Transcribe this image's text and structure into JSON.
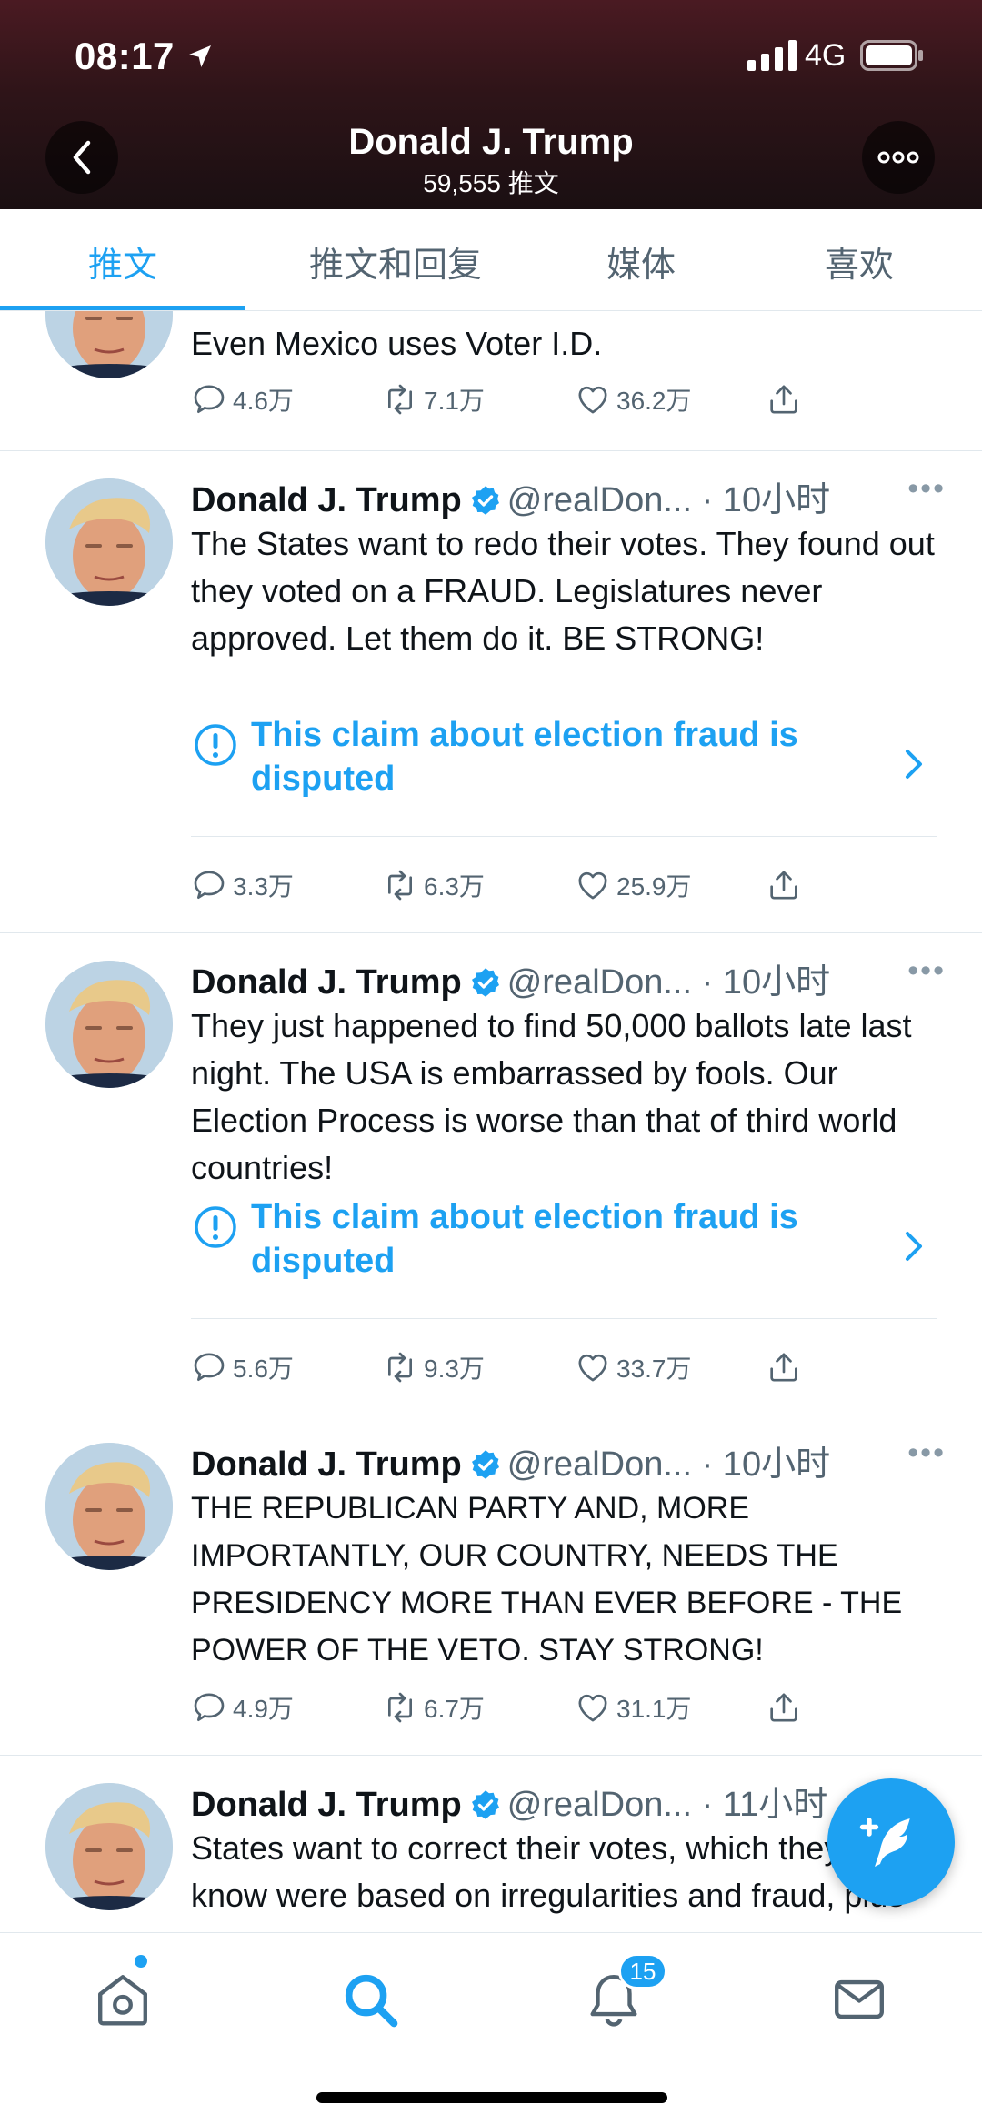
{
  "status_bar": {
    "time": "08:17",
    "network": "4G"
  },
  "header": {
    "title": "Donald J. Trump",
    "subtitle": "59,555 推文"
  },
  "tabs": [
    {
      "label": "推文",
      "active": true
    },
    {
      "label": "推文和回复",
      "active": false
    },
    {
      "label": "媒体",
      "active": false
    },
    {
      "label": "喜欢",
      "active": false
    }
  ],
  "tweets": [
    {
      "name": "Donald J. Trump",
      "handle": "@realDon...",
      "time": "· 10小时",
      "text": "Even Mexico uses Voter I.D.",
      "replies": "4.6万",
      "retweets": "7.1万",
      "likes": "36.2万"
    },
    {
      "name": "Donald J. Trump",
      "handle": "@realDon...",
      "time": "· 10小时",
      "text": "The States want to redo their votes. They found out they voted on a FRAUD. Legislatures never approved. Let them do it. BE STRONG!",
      "notice": "This claim about election fraud is disputed",
      "replies": "3.3万",
      "retweets": "6.3万",
      "likes": "25.9万"
    },
    {
      "name": "Donald J. Trump",
      "handle": "@realDon...",
      "time": "· 10小时",
      "text": "They just happened to find 50,000 ballots late last night. The USA is embarrassed by fools. Our Election Process is worse than that of third world countries!",
      "notice": "This claim about election fraud is disputed",
      "replies": "5.6万",
      "retweets": "9.3万",
      "likes": "33.7万"
    },
    {
      "name": "Donald J. Trump",
      "handle": "@realDon...",
      "time": "· 10小时",
      "text": "THE REPUBLICAN PARTY AND, MORE IMPORTANTLY, OUR COUNTRY, NEEDS THE PRESIDENCY MORE THAN EVER BEFORE - THE POWER OF THE VETO. STAY STRONG!",
      "replies": "4.9万",
      "retweets": "6.7万",
      "likes": "31.1万"
    },
    {
      "name": "Donald J. Trump",
      "handle": "@realDon...",
      "time": "· 11小时",
      "text": "States want to correct their votes, which they now know were based on irregularities and fraud, plus corrupt process never"
    }
  ],
  "bottom_nav": {
    "notification_count": "15"
  },
  "colors": {
    "accent": "#1da1f2",
    "text": "#0f1419",
    "muted": "#536471"
  }
}
